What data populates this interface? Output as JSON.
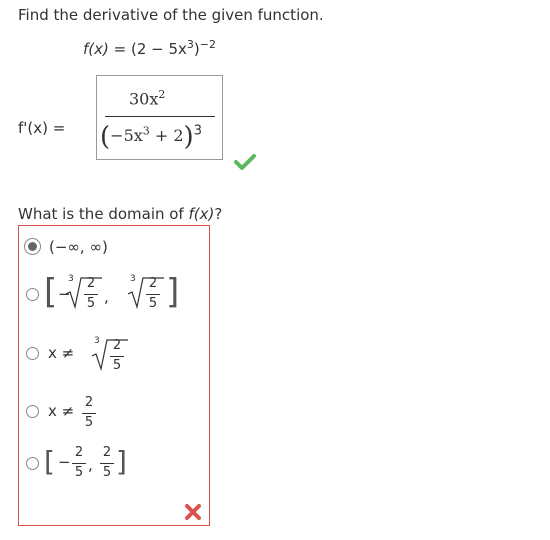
{
  "question": {
    "prompt": "Find the derivative of the given function.",
    "function": {
      "lhs": "f(x) = ",
      "base": "(2 − 5x",
      "inner_exp": "3",
      "close": ")",
      "outer_exp": "−2"
    }
  },
  "answer": {
    "label": "f'(x) =",
    "numerator_coef": "30x",
    "numerator_exp": "2",
    "den_open": "(",
    "den_body": "−5x",
    "den_exp": "3",
    "den_plus": " + 2",
    "den_close": ")",
    "den_outer_exp": "3",
    "status": "correct",
    "status_color": "#5cb85c"
  },
  "domain_question": {
    "prefix": "What is the domain of ",
    "fx": "f(x)",
    "suffix": "?"
  },
  "options": [
    {
      "id": "a",
      "text": "(−∞, ∞)",
      "selected": true
    },
    {
      "id": "b",
      "open": "[",
      "neg": "−",
      "root_index": "3",
      "num": "2",
      "den": "5",
      "comma": ",",
      "root_index2": "3",
      "num2": "2",
      "den2": "5",
      "close": "]",
      "selected": false
    },
    {
      "id": "c",
      "prefix": "x ≠",
      "root_index": "3",
      "num": "2",
      "den": "5",
      "selected": false
    },
    {
      "id": "d",
      "prefix": "x ≠",
      "num": "2",
      "den": "5",
      "selected": false
    },
    {
      "id": "e",
      "open": "[",
      "neg": "−",
      "num": "2",
      "den": "5",
      "comma": ",",
      "num2": "2",
      "den2": "5",
      "close": "]",
      "selected": false
    }
  ],
  "result": {
    "status": "incorrect",
    "status_color": "#d9534f"
  },
  "icons": {
    "check": "check-icon",
    "cross": "cross-icon"
  }
}
